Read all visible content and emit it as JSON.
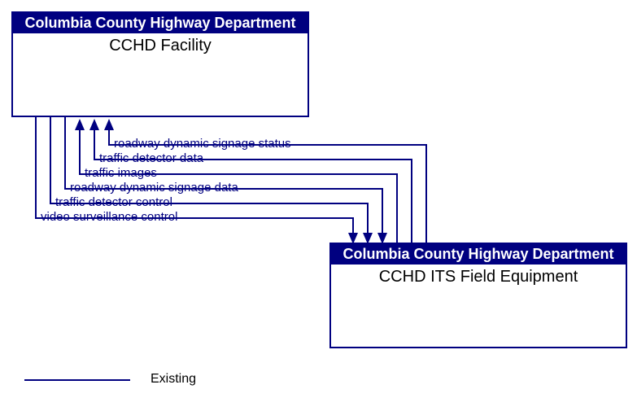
{
  "nodes": {
    "source": {
      "header": "Columbia County Highway Department",
      "body": "CCHD Facility"
    },
    "dest": {
      "header": "Columbia County Highway Department",
      "body": "CCHD ITS Field Equipment"
    }
  },
  "flows": {
    "f1": "roadway dynamic signage status",
    "f2": "traffic detector data",
    "f3": "traffic images",
    "f4": "roadway dynamic signage data",
    "f5": "traffic detector control",
    "f6": "video surveillance control"
  },
  "legend": {
    "existing": "Existing"
  }
}
